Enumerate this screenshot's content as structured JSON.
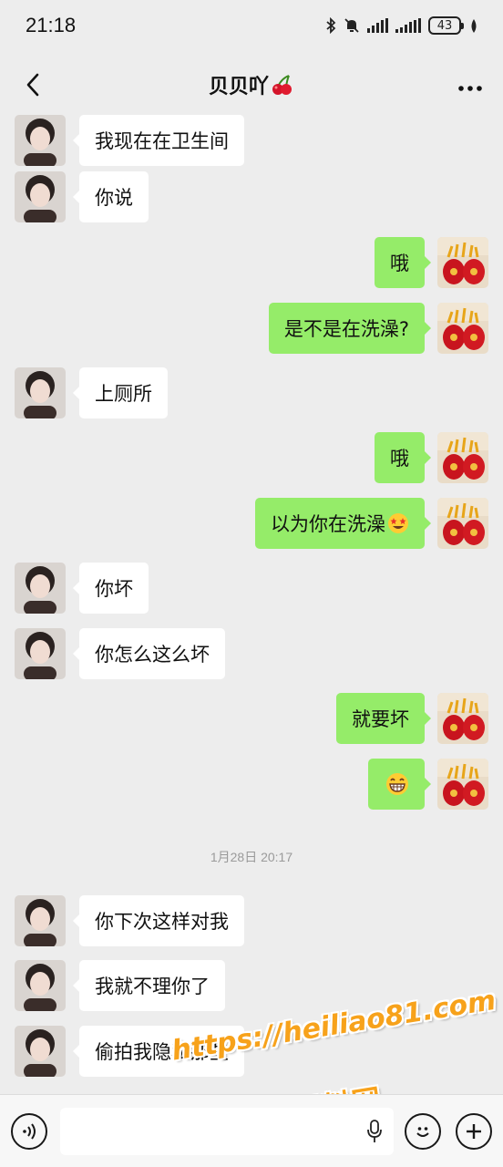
{
  "status_bar": {
    "time": "21:18",
    "battery": "43",
    "icons": [
      "bluetooth-icon",
      "mute-bell-icon",
      "signal-icon",
      "signal-icon",
      "battery-icon",
      "leaf-icon"
    ]
  },
  "header": {
    "title": "贝贝吖",
    "title_emoji": "cherry-icon",
    "back_icon": "chevron-left-icon",
    "more_icon": "more-dots-icon"
  },
  "messages": [
    {
      "side": "left",
      "text": "我现在在卫生间"
    },
    {
      "side": "left",
      "text": "你说"
    },
    {
      "side": "right",
      "text": "哦"
    },
    {
      "side": "right",
      "text": "是不是在洗澡?"
    },
    {
      "side": "left",
      "text": "上厕所"
    },
    {
      "side": "right",
      "text": "哦"
    },
    {
      "side": "right",
      "text": "以为你在洗澡",
      "emoji": "star-struck-emoji"
    },
    {
      "side": "left",
      "text": "你坏"
    },
    {
      "side": "left",
      "text": "你怎么这么坏"
    },
    {
      "side": "right",
      "text": "就要坏"
    },
    {
      "side": "right",
      "text": "",
      "emoji": "grinning-emoji"
    },
    {
      "side": "left",
      "text": "你下次这样对我"
    },
    {
      "side": "left",
      "text": "我就不理你了"
    },
    {
      "side": "left",
      "text": "偷拍我隐私那些"
    }
  ],
  "timestamp": "1月28日 20:17",
  "input_bar": {
    "voice_icon": "voice-icon",
    "mic_icon": "mic-icon",
    "emoji_icon": "emoji-icon",
    "plus_icon": "plus-icon"
  },
  "watermark": {
    "line1": "https://heiliao81.com",
    "line2": "黑料网"
  },
  "colors": {
    "background": "#ededed",
    "bubble_self": "#95ec69",
    "bubble_other": "#ffffff",
    "watermark": "#f7a21b"
  }
}
